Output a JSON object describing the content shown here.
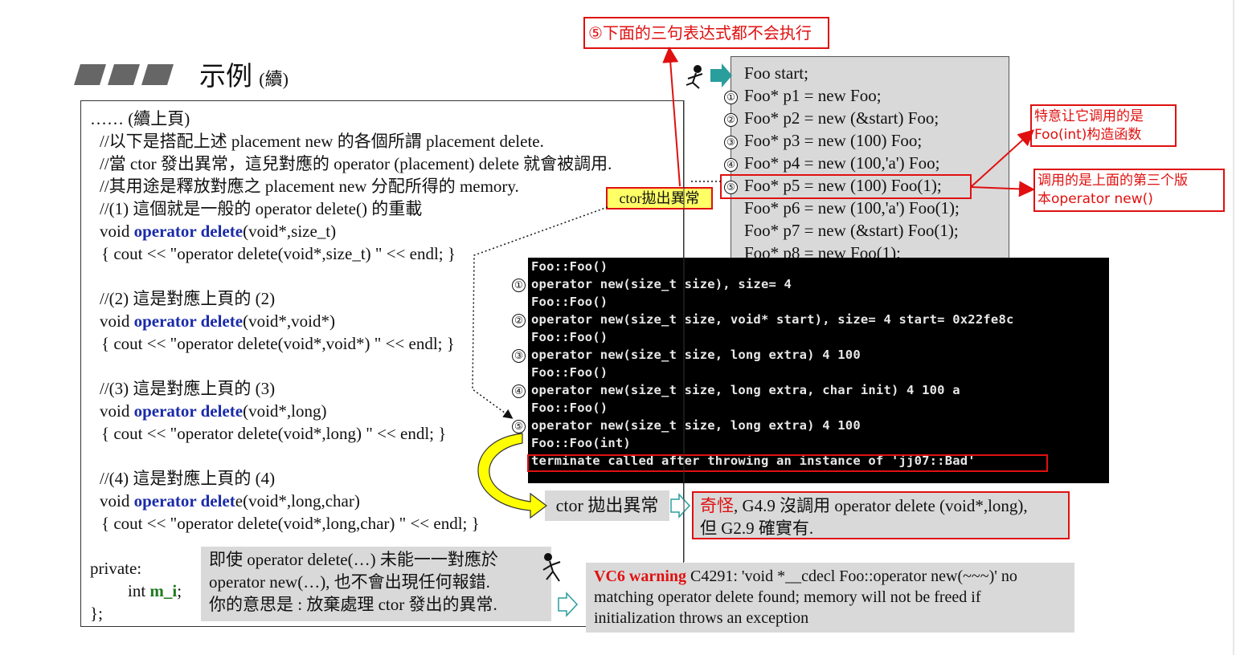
{
  "header": {
    "title": "示例",
    "title_suffix": "(續)",
    "annotation_top": "⑤下面的三句表达式都不会执行"
  },
  "code": {
    "lines": [
      "…… (續上頁)",
      "//以下是搭配上述 placement new 的各個所謂 placement delete.",
      "//當 ctor 發出異常，這兒對應的 operator (placement) delete 就會被調用.",
      "//其用途是釋放對應之 placement new 分配所得的 memory.",
      "//(1) 這個就是一般的 operator delete() 的重載"
    ],
    "blocks": [
      {
        "kw": "void",
        "fn": "operator delete",
        "params": "(void*,size_t)",
        "body": "{ cout << \"operator delete(void*,size_t)  \" << endl;  }"
      },
      {
        "comment": "//(2) 這是對應上頁的 (2)",
        "kw": "void",
        "fn": "operator delete",
        "params": "(void*,void*)",
        "body": "{ cout << \"operator delete(void*,void*)  \" << endl;  }"
      },
      {
        "comment": "//(3) 這是對應上頁的 (3)",
        "kw": "void",
        "fn": "operator delete",
        "params": "(void*,long)",
        "body": "{ cout << \"operator delete(void*,long)  \" << endl;  }"
      },
      {
        "comment": "//(4) 這是對應上頁的 (4)",
        "kw": "void",
        "fn": "operator delete",
        "params": "e(void*,long,char)",
        "fn_short": "operator delet",
        "body": "{ cout << \"operator delete(void*,long,char)  \" << endl; }"
      }
    ],
    "private_label": "private:",
    "member_type": "int",
    "member_name": "m_i",
    "member_end": ";",
    "class_end": "};"
  },
  "ctor_tag": "ctor拋出異常",
  "statements": {
    "lines": [
      {
        "num": "",
        "text": "Foo start;"
      },
      {
        "num": "①",
        "text": "Foo* p1 = new Foo;"
      },
      {
        "num": "②",
        "text": "Foo* p2 = new (&start) Foo;"
      },
      {
        "num": "③",
        "text": "Foo* p3 = new (100) Foo;"
      },
      {
        "num": "④",
        "text": "Foo* p4 = new (100,'a') Foo;"
      },
      {
        "num": "⑤",
        "text": "Foo* p5 = new (100) Foo(1);"
      },
      {
        "num": "",
        "text": "Foo* p6 = new (100,'a') Foo(1);"
      },
      {
        "num": "",
        "text": "Foo* p7 = new (&start) Foo(1);"
      },
      {
        "num": "",
        "text": "Foo* p8 = new Foo(1);"
      }
    ]
  },
  "annotations": {
    "foo_int": [
      "特意让它调用的是",
      "Foo(int)构造函数"
    ],
    "third_version": [
      "调用的是上面的第三个版",
      "本operator new()"
    ]
  },
  "console": {
    "lines": [
      {
        "num": "",
        "text": "Foo::Foo()"
      },
      {
        "num": "①",
        "text": "operator new(size_t size), size= 4"
      },
      {
        "num": "",
        "text": "Foo::Foo()"
      },
      {
        "num": "②",
        "text": "operator new(size_t size, void* start), size= 4  start= 0x22fe8c"
      },
      {
        "num": "",
        "text": "Foo::Foo()"
      },
      {
        "num": "③",
        "text": "operator new(size_t size, long extra)  4 100"
      },
      {
        "num": "",
        "text": "Foo::Foo()"
      },
      {
        "num": "④",
        "text": "operator new(size_t size, long extra, char init)  4 100 a"
      },
      {
        "num": "",
        "text": "Foo::Foo()"
      },
      {
        "num": "⑤",
        "text": "operator new(size_t size, long extra)  4 100"
      },
      {
        "num": "",
        "text": "Foo::Foo(int)"
      },
      {
        "num": "",
        "text": "terminate called after throwing an instance of 'jj07::Bad'"
      }
    ]
  },
  "ctor_throw_label": "ctor 拋出異常",
  "strange_note": {
    "red_word": "奇怪",
    "line1_rest": ", G4.9 沒調用 operator delete (void*,long),",
    "line2": "但 G2.9 確實有."
  },
  "gray_note": [
    "即使 operator delete(…) 未能一一對應於",
    "operator new(…), 也不會出現任何報錯.",
    "你的意思是 : 放棄處理 ctor 發出的異常."
  ],
  "vc6": {
    "label": "VC6 warning",
    "line1_rest": " C4291: 'void *__cdecl Foo::operator new(~~~)'  no",
    "line2": "matching operator delete found; memory will not be freed if",
    "line3": "initialization throws an exception"
  },
  "colors": {
    "accent_red": "#e01010",
    "keyword_blue": "#1a2ba8",
    "member_green": "#1f7a1f",
    "gray_box": "#d9d9d9",
    "teal_arrow": "#2a9d9d",
    "yellow_arrow": "#ffff00"
  }
}
